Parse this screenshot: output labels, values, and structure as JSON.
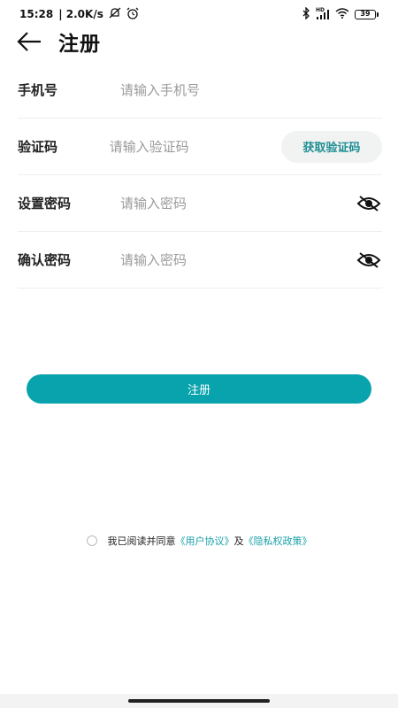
{
  "status_bar": {
    "time": "15:28",
    "speed": "| 2.0K/s",
    "battery": "39",
    "network": "HD"
  },
  "header": {
    "title": "注册"
  },
  "form": {
    "phone": {
      "label": "手机号",
      "placeholder": "请输入手机号"
    },
    "code": {
      "label": "验证码",
      "placeholder": "请输入验证码",
      "button": "获取验证码"
    },
    "password": {
      "label": "设置密码",
      "placeholder": "请输入密码"
    },
    "confirm": {
      "label": "确认密码",
      "placeholder": "请输入密码"
    }
  },
  "register_button": "注册",
  "agreement": {
    "prefix": "我已阅读并同意",
    "user_agreement": "《用户协议》",
    "conjunction": "及",
    "privacy_policy": "《隐私权政策》"
  },
  "colors": {
    "accent": "#08a3ad",
    "link": "#1aa0a8"
  }
}
